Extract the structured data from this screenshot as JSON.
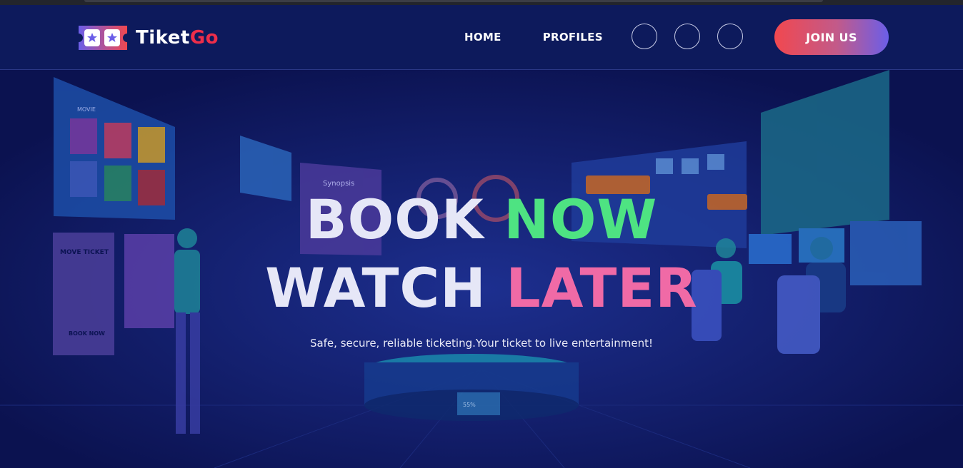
{
  "brand": {
    "name_part1": "Tiket",
    "name_part2": "Go"
  },
  "nav": {
    "items": [
      {
        "label": "HOME"
      },
      {
        "label": "PROFILES"
      }
    ]
  },
  "social": {
    "icons": [
      "social-icon-1",
      "social-icon-2",
      "social-icon-3"
    ]
  },
  "cta": {
    "join_label": "JOIN US"
  },
  "hero": {
    "line1_white": "BOOK",
    "line1_green": "NOW",
    "line2_white": "WATCH",
    "line2_pink": "LATER",
    "tagline": "Safe, secure, reliable ticketing.Your ticket to live entertainment!"
  },
  "illustration": {
    "poster_title": "MOVE TICKET",
    "poster_sub": "BOOK NOW",
    "screen_label": "Synopsis",
    "panel_label": "MOVIE",
    "gauge_value": "55%"
  },
  "colors": {
    "header_bg": "#0d1a5c",
    "hero_bg": "#0b1250",
    "brand_accent": "#ee2e4a",
    "green": "#4ee382",
    "pink": "#f06aa6"
  }
}
